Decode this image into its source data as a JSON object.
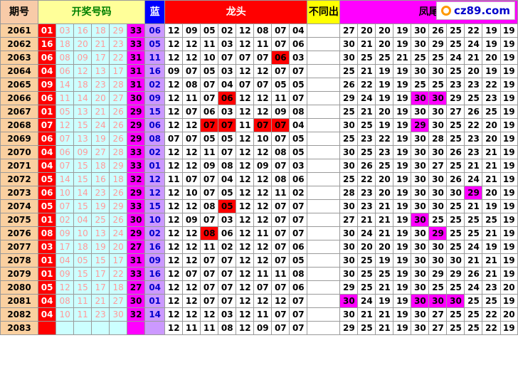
{
  "header": {
    "period": "期号",
    "draw": "开奖号码",
    "blue": "蓝",
    "dragon": "龙头",
    "no_diff": "不同出",
    "phoenix": "凤尾"
  },
  "logo": {
    "text": "cz89.com"
  },
  "rows": [
    {
      "period": "2061",
      "reds": [
        "01",
        "03",
        "16",
        "18",
        "29",
        "33"
      ],
      "blue": "06",
      "dragon": [
        "12",
        "09",
        "05",
        "02",
        "12",
        "08",
        "07",
        "04"
      ],
      "dragon_hl": [],
      "phoenix": [
        "27",
        "20",
        "20",
        "19",
        "30",
        "26",
        "25",
        "22",
        "19",
        "19"
      ],
      "phoenix_hl": []
    },
    {
      "period": "2062",
      "reds": [
        "16",
        "18",
        "20",
        "21",
        "23",
        "33"
      ],
      "blue": "05",
      "dragon": [
        "12",
        "12",
        "11",
        "03",
        "12",
        "11",
        "07",
        "06"
      ],
      "dragon_hl": [],
      "phoenix": [
        "30",
        "21",
        "20",
        "19",
        "30",
        "29",
        "25",
        "24",
        "19",
        "19"
      ],
      "phoenix_hl": []
    },
    {
      "period": "2063",
      "reds": [
        "06",
        "08",
        "09",
        "17",
        "22",
        "31"
      ],
      "blue": "11",
      "dragon": [
        "12",
        "12",
        "10",
        "07",
        "07",
        "07",
        "06",
        "03"
      ],
      "dragon_hl": [
        6
      ],
      "phoenix": [
        "30",
        "25",
        "25",
        "21",
        "25",
        "25",
        "24",
        "21",
        "20",
        "19"
      ],
      "phoenix_hl": []
    },
    {
      "period": "2064",
      "reds": [
        "04",
        "06",
        "12",
        "13",
        "17",
        "31"
      ],
      "blue": "16",
      "dragon": [
        "09",
        "07",
        "05",
        "03",
        "12",
        "12",
        "07",
        "07"
      ],
      "dragon_hl": [],
      "phoenix": [
        "25",
        "21",
        "19",
        "19",
        "30",
        "30",
        "25",
        "20",
        "19",
        "19"
      ],
      "phoenix_hl": []
    },
    {
      "period": "2065",
      "reds": [
        "09",
        "14",
        "18",
        "23",
        "28",
        "31"
      ],
      "blue": "02",
      "dragon": [
        "12",
        "08",
        "07",
        "04",
        "07",
        "07",
        "05",
        "05"
      ],
      "dragon_hl": [],
      "phoenix": [
        "26",
        "22",
        "19",
        "19",
        "25",
        "25",
        "23",
        "23",
        "22",
        "19"
      ],
      "phoenix_hl": []
    },
    {
      "period": "2066",
      "reds": [
        "06",
        "11",
        "14",
        "20",
        "27",
        "30"
      ],
      "blue": "09",
      "dragon": [
        "12",
        "11",
        "07",
        "06",
        "12",
        "12",
        "11",
        "07"
      ],
      "dragon_hl": [
        3
      ],
      "phoenix": [
        "29",
        "24",
        "19",
        "19",
        "30",
        "30",
        "29",
        "25",
        "23",
        "19"
      ],
      "phoenix_hl": [
        4,
        5
      ]
    },
    {
      "period": "2067",
      "reds": [
        "01",
        "05",
        "13",
        "21",
        "26",
        "29"
      ],
      "blue": "15",
      "dragon": [
        "12",
        "07",
        "06",
        "03",
        "12",
        "12",
        "09",
        "08"
      ],
      "dragon_hl": [],
      "phoenix": [
        "25",
        "21",
        "20",
        "19",
        "30",
        "30",
        "27",
        "26",
        "25",
        "19"
      ],
      "phoenix_hl": []
    },
    {
      "period": "2068",
      "reds": [
        "07",
        "12",
        "15",
        "24",
        "26",
        "29"
      ],
      "blue": "06",
      "dragon": [
        "12",
        "12",
        "07",
        "07",
        "11",
        "07",
        "07",
        "04"
      ],
      "dragon_hl": [
        2,
        3,
        5,
        6
      ],
      "phoenix": [
        "30",
        "25",
        "19",
        "19",
        "29",
        "30",
        "25",
        "22",
        "20",
        "19"
      ],
      "phoenix_hl": [
        4
      ]
    },
    {
      "period": "2069",
      "reds": [
        "06",
        "07",
        "13",
        "19",
        "26",
        "29"
      ],
      "blue": "08",
      "dragon": [
        "07",
        "07",
        "05",
        "05",
        "12",
        "10",
        "07",
        "05"
      ],
      "dragon_hl": [],
      "phoenix": [
        "25",
        "23",
        "22",
        "19",
        "30",
        "28",
        "25",
        "23",
        "20",
        "19"
      ],
      "phoenix_hl": []
    },
    {
      "period": "2070",
      "reds": [
        "04",
        "06",
        "09",
        "27",
        "28",
        "33"
      ],
      "blue": "02",
      "dragon": [
        "12",
        "12",
        "11",
        "07",
        "12",
        "12",
        "08",
        "05"
      ],
      "dragon_hl": [],
      "phoenix": [
        "30",
        "25",
        "23",
        "19",
        "30",
        "30",
        "26",
        "23",
        "21",
        "19"
      ],
      "phoenix_hl": []
    },
    {
      "period": "2071",
      "reds": [
        "04",
        "07",
        "15",
        "18",
        "29",
        "33"
      ],
      "blue": "01",
      "dragon": [
        "12",
        "12",
        "09",
        "08",
        "12",
        "09",
        "07",
        "03"
      ],
      "dragon_hl": [],
      "phoenix": [
        "30",
        "26",
        "25",
        "19",
        "30",
        "27",
        "25",
        "21",
        "21",
        "19"
      ],
      "phoenix_hl": []
    },
    {
      "period": "2072",
      "reds": [
        "05",
        "14",
        "15",
        "16",
        "18",
        "32"
      ],
      "blue": "12",
      "dragon": [
        "11",
        "07",
        "07",
        "04",
        "12",
        "12",
        "08",
        "06"
      ],
      "dragon_hl": [],
      "phoenix": [
        "25",
        "22",
        "20",
        "19",
        "30",
        "30",
        "26",
        "24",
        "21",
        "19"
      ],
      "phoenix_hl": []
    },
    {
      "period": "2073",
      "reds": [
        "06",
        "10",
        "14",
        "23",
        "26",
        "29"
      ],
      "blue": "12",
      "dragon": [
        "12",
        "10",
        "07",
        "05",
        "12",
        "12",
        "11",
        "02"
      ],
      "dragon_hl": [],
      "phoenix": [
        "28",
        "23",
        "20",
        "19",
        "30",
        "30",
        "30",
        "29",
        "20",
        "19"
      ],
      "phoenix_hl": [
        7
      ]
    },
    {
      "period": "2074",
      "reds": [
        "05",
        "07",
        "15",
        "19",
        "29",
        "33"
      ],
      "blue": "15",
      "dragon": [
        "12",
        "12",
        "08",
        "05",
        "12",
        "12",
        "07",
        "07"
      ],
      "dragon_hl": [
        3
      ],
      "phoenix": [
        "30",
        "23",
        "21",
        "19",
        "30",
        "30",
        "25",
        "21",
        "19",
        "19"
      ],
      "phoenix_hl": []
    },
    {
      "period": "2075",
      "reds": [
        "01",
        "02",
        "04",
        "25",
        "26",
        "30"
      ],
      "blue": "10",
      "dragon": [
        "12",
        "09",
        "07",
        "03",
        "12",
        "12",
        "07",
        "07"
      ],
      "dragon_hl": [],
      "phoenix": [
        "27",
        "21",
        "21",
        "19",
        "30",
        "25",
        "25",
        "25",
        "25",
        "19"
      ],
      "phoenix_hl": [
        4
      ]
    },
    {
      "period": "2076",
      "reds": [
        "08",
        "09",
        "10",
        "13",
        "24",
        "29"
      ],
      "blue": "02",
      "dragon": [
        "12",
        "12",
        "08",
        "06",
        "12",
        "11",
        "07",
        "07"
      ],
      "dragon_hl": [
        2
      ],
      "phoenix": [
        "30",
        "24",
        "21",
        "19",
        "30",
        "29",
        "25",
        "25",
        "21",
        "19"
      ],
      "phoenix_hl": [
        5
      ]
    },
    {
      "period": "2077",
      "reds": [
        "03",
        "17",
        "18",
        "19",
        "20",
        "27"
      ],
      "blue": "16",
      "dragon": [
        "12",
        "12",
        "11",
        "02",
        "12",
        "12",
        "07",
        "06"
      ],
      "dragon_hl": [],
      "phoenix": [
        "30",
        "20",
        "20",
        "19",
        "30",
        "30",
        "25",
        "24",
        "19",
        "19"
      ],
      "phoenix_hl": []
    },
    {
      "period": "2078",
      "reds": [
        "01",
        "04",
        "05",
        "15",
        "17",
        "31"
      ],
      "blue": "09",
      "dragon": [
        "12",
        "12",
        "07",
        "07",
        "12",
        "12",
        "07",
        "05"
      ],
      "dragon_hl": [],
      "phoenix": [
        "30",
        "25",
        "19",
        "19",
        "30",
        "30",
        "30",
        "21",
        "21",
        "19"
      ],
      "phoenix_hl": []
    },
    {
      "period": "2079",
      "reds": [
        "01",
        "09",
        "15",
        "17",
        "22",
        "33"
      ],
      "blue": "16",
      "dragon": [
        "12",
        "07",
        "07",
        "07",
        "12",
        "11",
        "11",
        "08"
      ],
      "dragon_hl": [],
      "phoenix": [
        "30",
        "25",
        "25",
        "19",
        "30",
        "29",
        "29",
        "26",
        "21",
        "19"
      ],
      "phoenix_hl": []
    },
    {
      "period": "2080",
      "reds": [
        "05",
        "12",
        "15",
        "17",
        "18",
        "27"
      ],
      "blue": "04",
      "dragon": [
        "12",
        "12",
        "07",
        "07",
        "12",
        "07",
        "07",
        "06"
      ],
      "dragon_hl": [],
      "phoenix": [
        "29",
        "25",
        "21",
        "19",
        "30",
        "25",
        "25",
        "24",
        "23",
        "20"
      ],
      "phoenix_hl": []
    },
    {
      "period": "2081",
      "reds": [
        "04",
        "08",
        "11",
        "21",
        "27",
        "30"
      ],
      "blue": "01",
      "dragon": [
        "12",
        "12",
        "07",
        "07",
        "12",
        "12",
        "12",
        "07"
      ],
      "dragon_hl": [],
      "phoenix": [
        "30",
        "24",
        "19",
        "19",
        "30",
        "30",
        "30",
        "25",
        "25",
        "19"
      ],
      "phoenix_hl": [
        0,
        4,
        5,
        6
      ]
    },
    {
      "period": "2082",
      "reds": [
        "04",
        "10",
        "11",
        "23",
        "30",
        "32"
      ],
      "blue": "14",
      "dragon": [
        "12",
        "12",
        "12",
        "03",
        "12",
        "11",
        "07",
        "07"
      ],
      "dragon_hl": [],
      "phoenix": [
        "30",
        "21",
        "21",
        "19",
        "30",
        "27",
        "25",
        "25",
        "22",
        "20"
      ],
      "phoenix_hl": []
    },
    {
      "period": "2083",
      "reds": [
        "",
        "",
        "",
        "",
        "",
        ""
      ],
      "blue": "",
      "dragon": [
        "12",
        "11",
        "11",
        "08",
        "12",
        "09",
        "07",
        "07"
      ],
      "dragon_hl": [],
      "phoenix": [
        "29",
        "25",
        "21",
        "19",
        "30",
        "27",
        "25",
        "25",
        "22",
        "19"
      ],
      "phoenix_hl": []
    }
  ]
}
